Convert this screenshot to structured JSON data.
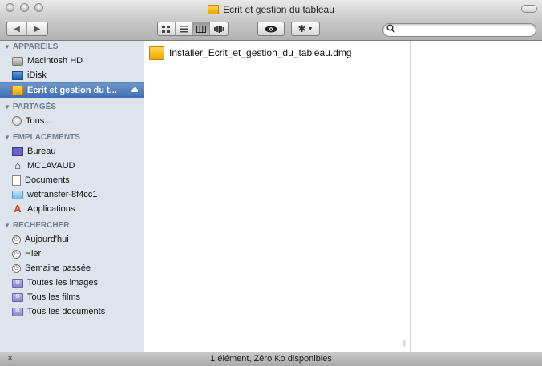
{
  "window": {
    "title": "Ecrit et gestion du tableau"
  },
  "toolbar": {
    "back_icon": "chevron-left-icon",
    "forward_icon": "chevron-right-icon",
    "views": [
      "icon-view",
      "list-view",
      "column-view",
      "coverflow-view"
    ],
    "active_view": "column-view",
    "search": {
      "value": "",
      "placeholder": ""
    }
  },
  "sidebar": {
    "sections": [
      {
        "title": "APPAREILS",
        "items": [
          {
            "label": "Macintosh HD",
            "icon": "hard-drive-icon"
          },
          {
            "label": "iDisk",
            "icon": "idisk-icon"
          },
          {
            "label": "Ecrit et gestion du t...",
            "icon": "disk-image-icon",
            "selected": true
          }
        ]
      },
      {
        "title": "PARTAGÉS",
        "items": [
          {
            "label": "Tous...",
            "icon": "network-globe-icon"
          }
        ]
      },
      {
        "title": "EMPLACEMENTS",
        "items": [
          {
            "label": "Bureau",
            "icon": "desktop-icon"
          },
          {
            "label": "MCLAVAUD",
            "icon": "home-icon"
          },
          {
            "label": "Documents",
            "icon": "documents-icon"
          },
          {
            "label": "wetransfer-8f4cc1",
            "icon": "folder-icon"
          },
          {
            "label": "Applications",
            "icon": "applications-icon"
          }
        ]
      },
      {
        "title": "RECHERCHER",
        "items": [
          {
            "label": "Aujourd'hui",
            "icon": "clock-icon"
          },
          {
            "label": "Hier",
            "icon": "clock-icon"
          },
          {
            "label": "Semaine passée",
            "icon": "clock-icon"
          },
          {
            "label": "Toutes les images",
            "icon": "smart-folder-icon"
          },
          {
            "label": "Tous les films",
            "icon": "smart-folder-icon"
          },
          {
            "label": "Tous les documents",
            "icon": "smart-folder-icon"
          }
        ]
      }
    ]
  },
  "content": {
    "files": [
      {
        "name": "Installer_Ecrit_et_gestion_du_tableau.dmg",
        "icon": "disk-image-icon"
      }
    ]
  },
  "status": {
    "text": "1 élément, Zéro Ko disponibles"
  }
}
